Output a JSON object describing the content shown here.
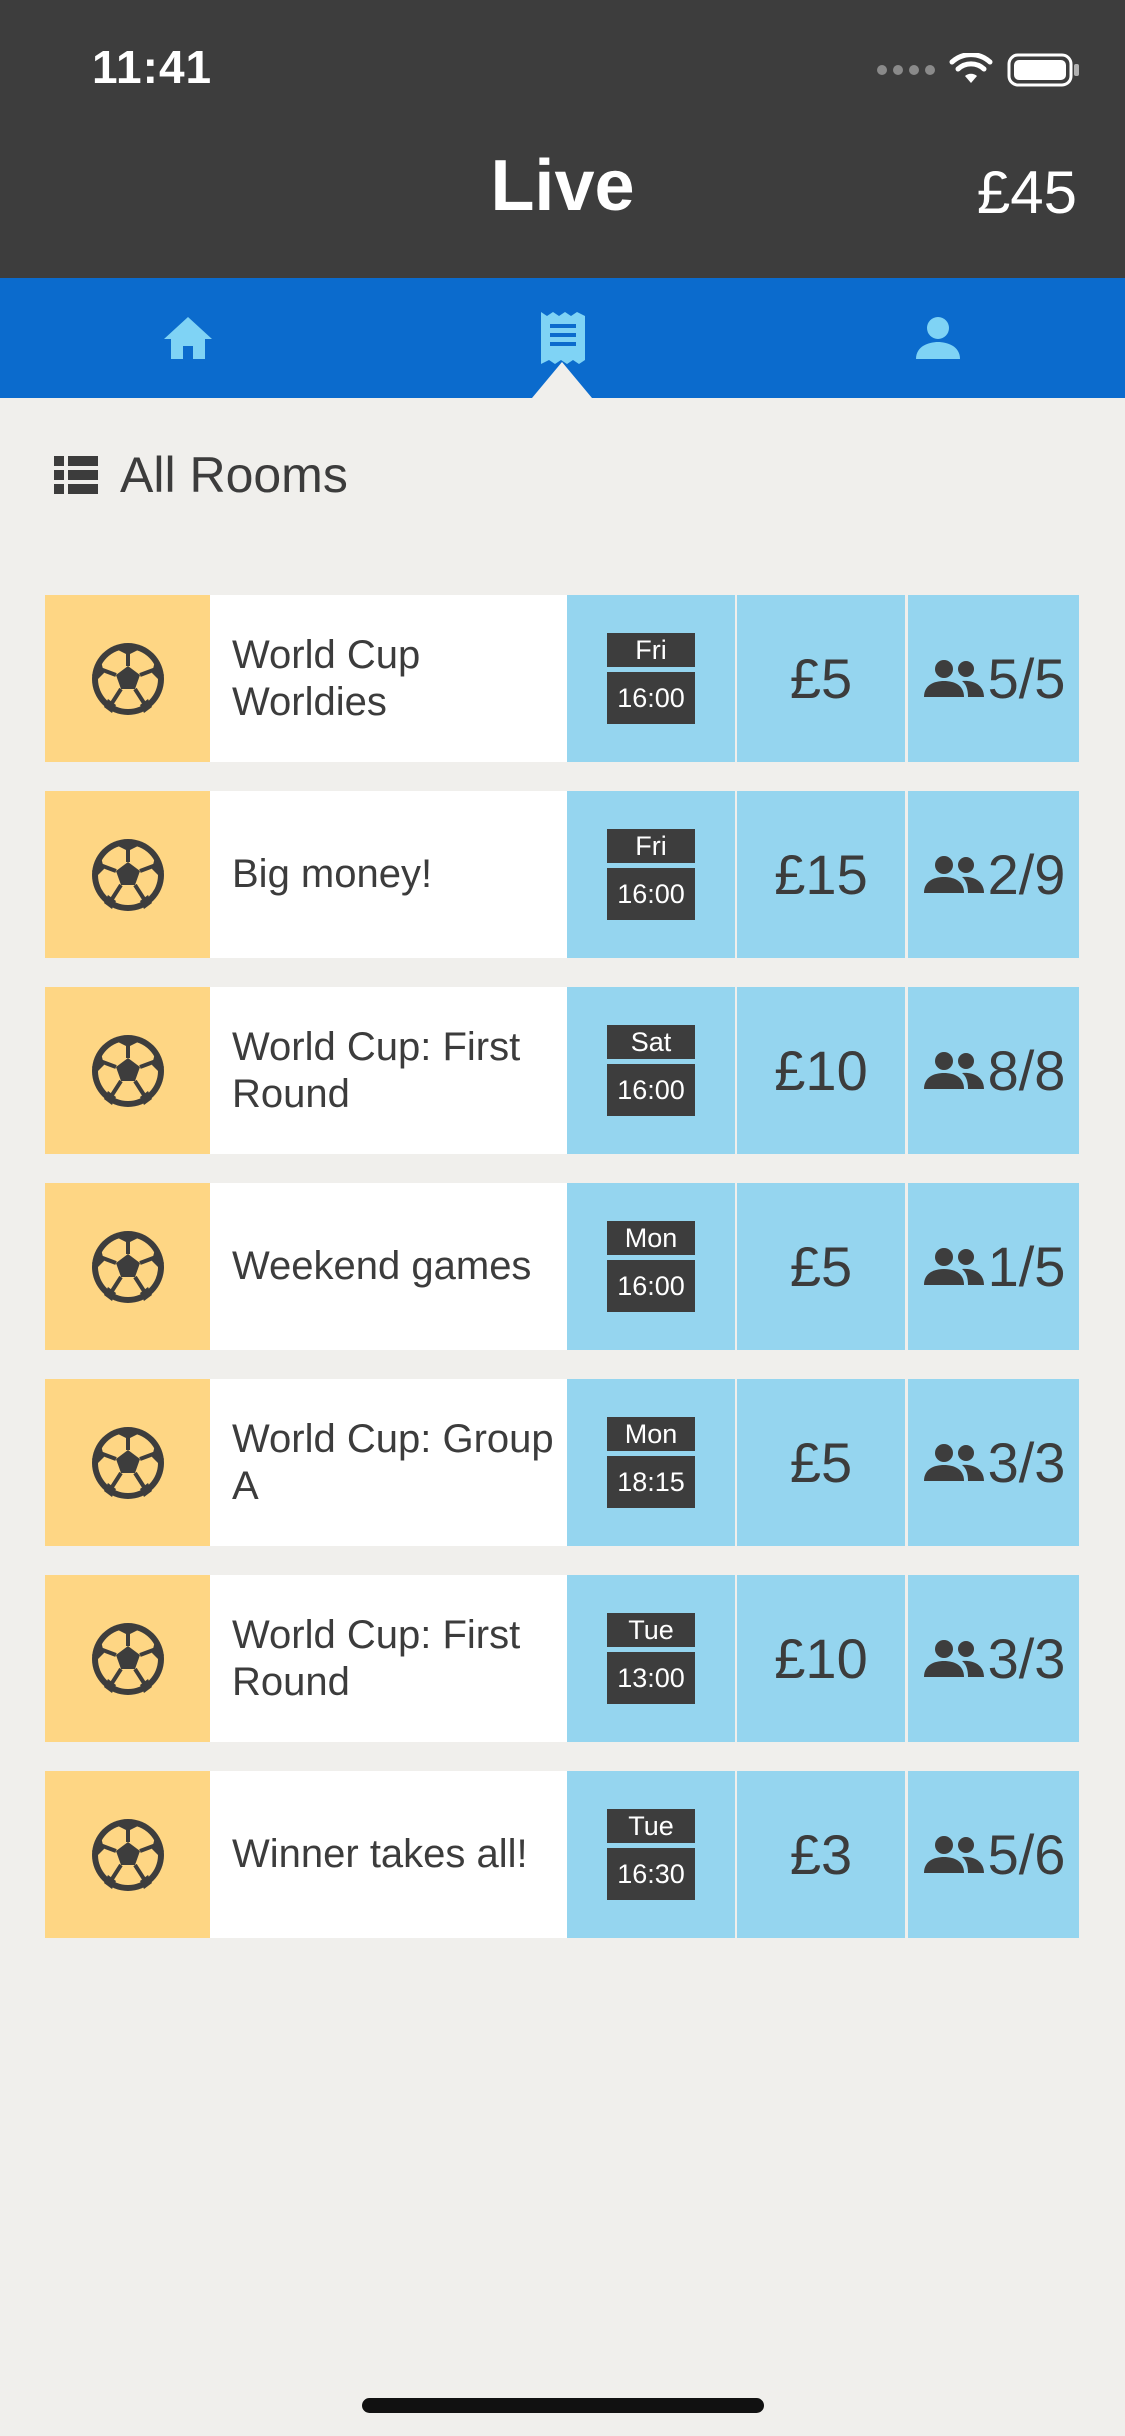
{
  "status_bar": {
    "time": "11:41"
  },
  "header": {
    "title": "Live",
    "balance": "£45"
  },
  "tabs": [
    {
      "name": "home",
      "icon": "home-icon",
      "selected": false
    },
    {
      "name": "receipt",
      "icon": "receipt-icon",
      "selected": true
    },
    {
      "name": "account",
      "icon": "person-icon",
      "selected": false
    }
  ],
  "section": {
    "title": "All Rooms"
  },
  "colors": {
    "header_bg": "#3d3d3d",
    "tabbar_bg": "#0b6bcd",
    "tab_icon": "#7fd3f5",
    "sport_bg": "#fed684",
    "info_bg": "#95d5ef",
    "page_bg": "#f0efec"
  },
  "rooms": [
    {
      "sport_icon": "soccer-ball-icon",
      "name": "World Cup Worldies",
      "day": "Fri",
      "time": "16:00",
      "fee": "£5",
      "players": "5/5"
    },
    {
      "sport_icon": "soccer-ball-icon",
      "name": "Big money!",
      "day": "Fri",
      "time": "16:00",
      "fee": "£15",
      "players": "2/9"
    },
    {
      "sport_icon": "soccer-ball-icon",
      "name": "World Cup: First Round",
      "day": "Sat",
      "time": "16:00",
      "fee": "£10",
      "players": "8/8"
    },
    {
      "sport_icon": "soccer-ball-icon",
      "name": "Weekend games",
      "day": "Mon",
      "time": "16:00",
      "fee": "£5",
      "players": "1/5"
    },
    {
      "sport_icon": "soccer-ball-icon",
      "name": "World Cup: Group A",
      "day": "Mon",
      "time": "18:15",
      "fee": "£5",
      "players": "3/3"
    },
    {
      "sport_icon": "soccer-ball-icon",
      "name": "World Cup: First Round",
      "day": "Tue",
      "time": "13:00",
      "fee": "£10",
      "players": "3/3"
    },
    {
      "sport_icon": "soccer-ball-icon",
      "name": "Winner takes all!",
      "day": "Tue",
      "time": "16:30",
      "fee": "£3",
      "players": "5/6"
    }
  ]
}
